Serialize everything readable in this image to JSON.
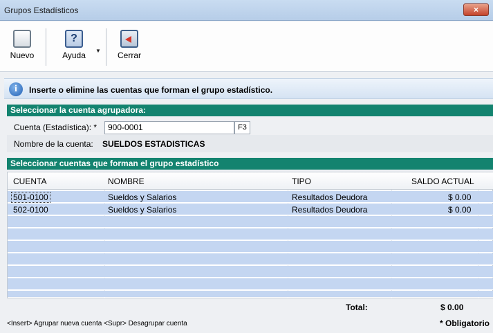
{
  "window": {
    "title": "Grupos Estadísticos",
    "close_glyph": "×"
  },
  "toolbar": {
    "nuevo": {
      "label": "Nuevo",
      "icon": "new-document-icon"
    },
    "ayuda": {
      "label": "Ayuda",
      "icon": "help-icon",
      "glyph": "?"
    },
    "cerrar": {
      "label": "Cerrar",
      "icon": "exit-icon"
    }
  },
  "info": {
    "icon": "info-icon",
    "glyph": "i",
    "text": "Inserte o elimine las cuentas que forman el grupo estadístico."
  },
  "section1": {
    "header": "Seleccionar la cuenta agrupadora:",
    "cuenta_label": "Cuenta (Estadística): *",
    "cuenta_value": "900-0001",
    "f3": "F3",
    "nombre_label": "Nombre de la cuenta:",
    "nombre_value": "SUELDOS ESTADISTICAS"
  },
  "section2": {
    "header": "Seleccionar cuentas que forman el grupo estadístico",
    "columns": [
      "CUENTA",
      "NOMBRE",
      "TIPO",
      "SALDO ACTUAL"
    ],
    "rows": [
      {
        "cuenta": "501-0100",
        "nombre": "Sueldos y Salarios",
        "tipo": "Resultados Deudora",
        "saldo": "$ 0.00"
      },
      {
        "cuenta": "502-0100",
        "nombre": "Sueldos y Salarios",
        "tipo": "Resultados Deudora",
        "saldo": "$ 0.00"
      }
    ]
  },
  "totals": {
    "label": "Total:",
    "value": "$ 0.00"
  },
  "footer": {
    "hint": "<Insert> Agrupar nueva cuenta    <Supr> Desagrupar cuenta",
    "required": "* Obligatorio"
  }
}
